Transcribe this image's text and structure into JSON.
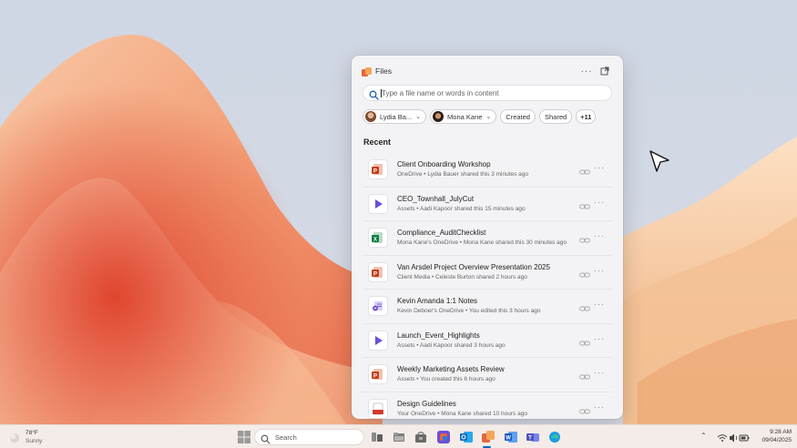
{
  "panel": {
    "title": "Files",
    "more_label": "···",
    "search": {
      "placeholder": "Type a file name or words in content"
    },
    "filters": {
      "person1": "Lydia Ba...",
      "person2": "Mona Kane",
      "created": "Created",
      "shared": "Shared",
      "more": "+11"
    },
    "recent_label": "Recent",
    "files": [
      {
        "name": "Client Onboarding Workshop",
        "meta": "OneDrive • Lydia Bauer shared this 3 minutes ago",
        "type": "powerpoint"
      },
      {
        "name": "CEO_Townhall_JulyCut",
        "meta": "Assets • Aadi Kapoor shared this 15 minutes ago",
        "type": "video"
      },
      {
        "name": "Compliance_AuditChecklist",
        "meta": "Mona Kane's OneDrive • Mona Kane shared this 30 minutes ago",
        "type": "excel"
      },
      {
        "name": "Van Arsdel Project Overview Presentation 2025",
        "meta": "Client Media • Celeste Burton shared 2 hours ago",
        "type": "powerpoint"
      },
      {
        "name": "Kevin Amanda 1:1 Notes",
        "meta": "Kevin Deboer's OneDrive • You edited this 3 hours ago",
        "type": "loop"
      },
      {
        "name": "Launch_Event_Highlights",
        "meta": "Assets • Aadi Kapoor shared 3 hours ago",
        "type": "video"
      },
      {
        "name": "Weekly Marketing Assets Review",
        "meta": "Assets • You created this 6 hours ago",
        "type": "powerpoint"
      },
      {
        "name": "Design Guidelines",
        "meta": "Your OneDrive • Mona Kane shared 10 hours ago",
        "type": "pdf"
      }
    ]
  },
  "taskbar": {
    "weather_temp": "78°F",
    "weather_condition": "Sunny",
    "search_label": "Search",
    "time": "9:28 AM",
    "date": "09/04/2025"
  },
  "colors": {
    "powerpoint": "#c43e1c",
    "excel": "#107c41",
    "video": "#6b4fd8",
    "loop": "#7a5bd6",
    "accent": "#0067c0"
  }
}
